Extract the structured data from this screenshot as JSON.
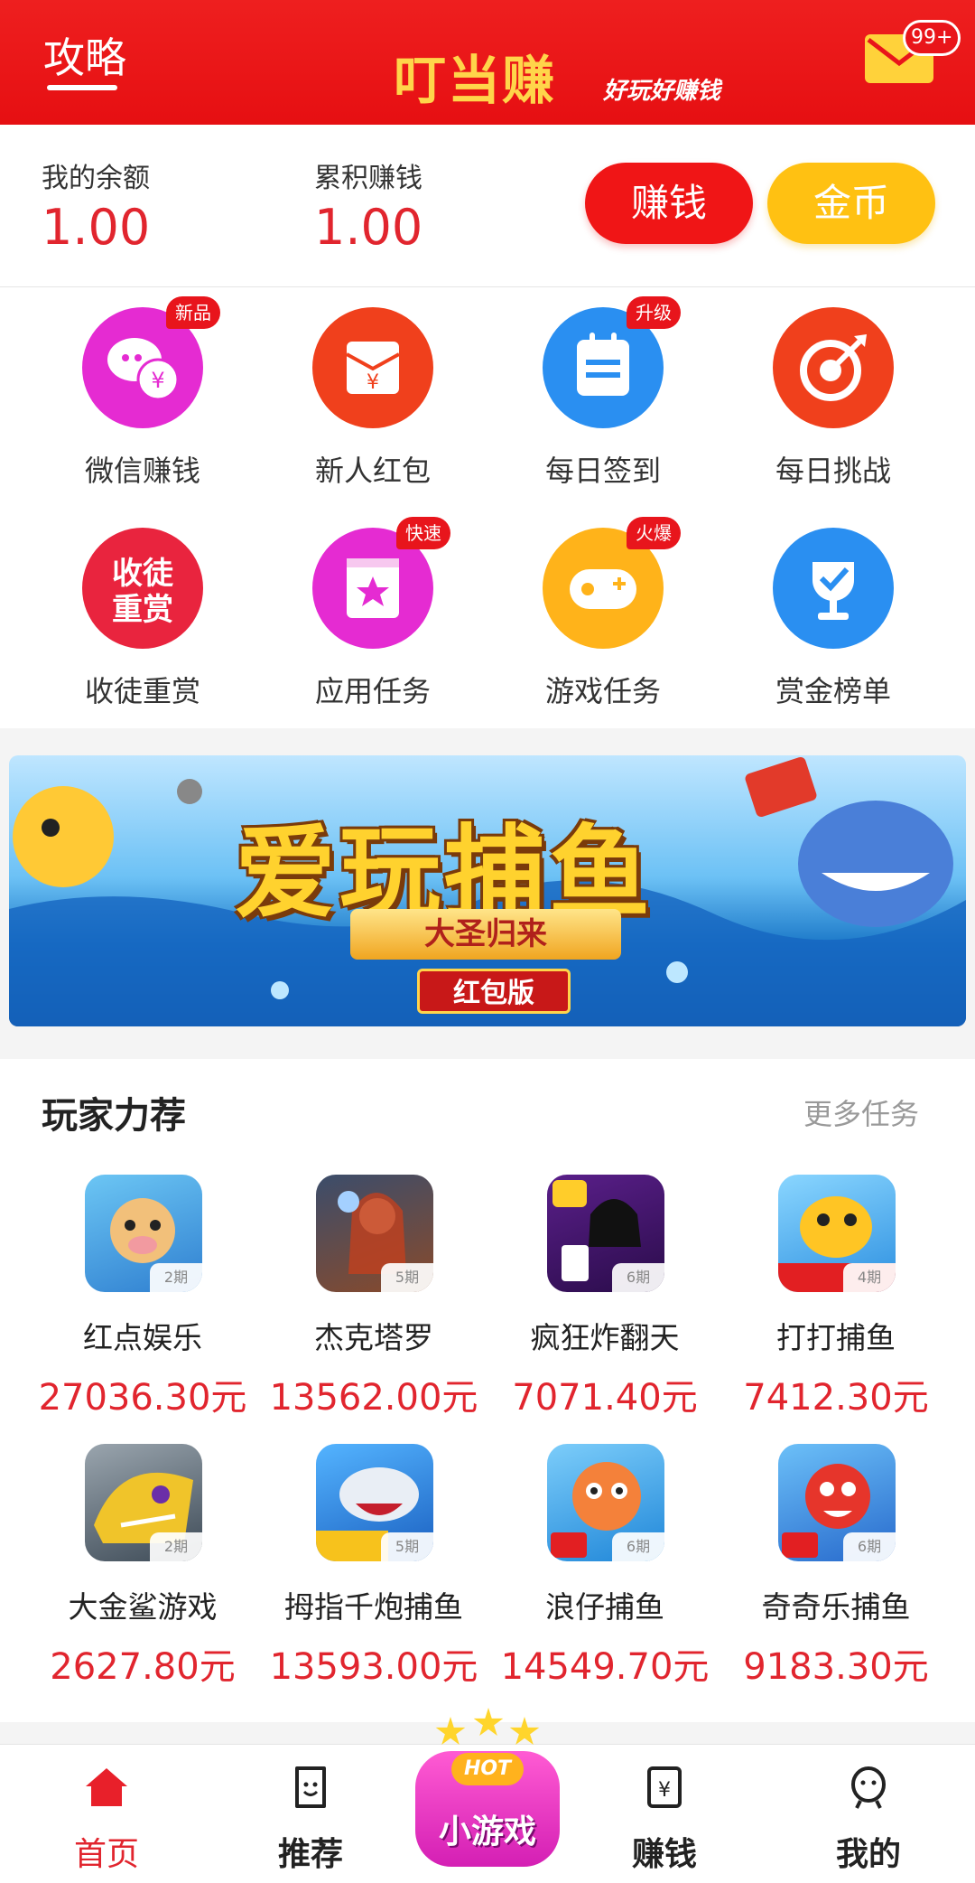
{
  "header": {
    "guide_label": "攻略",
    "brand": "叮当赚",
    "slogan": "好玩好赚钱",
    "mail_badge": "99+"
  },
  "balance": {
    "my_balance_label": "我的余额",
    "my_balance_value": "1.00",
    "total_earned_label": "累积赚钱",
    "total_earned_value": "1.00",
    "earn_button": "赚钱",
    "coin_button": "金币"
  },
  "grid": [
    {
      "label": "微信赚钱",
      "tag": "新品",
      "icon": "wechat-money-icon",
      "color": "#e52bd2"
    },
    {
      "label": "新人红包",
      "tag": "",
      "icon": "red-envelope-icon",
      "color": "#f0401c"
    },
    {
      "label": "每日签到",
      "tag": "升级",
      "icon": "calendar-icon",
      "color": "#2a8ff1"
    },
    {
      "label": "每日挑战",
      "tag": "",
      "icon": "target-icon",
      "color": "#f0401c"
    },
    {
      "label": "收徒重赏",
      "tag": "",
      "icon": "recruit-icon",
      "color": "#e9243e",
      "icon_text": [
        "收徒",
        "重赏"
      ]
    },
    {
      "label": "应用任务",
      "tag": "快速",
      "icon": "app-star-icon",
      "color": "#e52bd2"
    },
    {
      "label": "游戏任务",
      "tag": "火爆",
      "icon": "gamepad-icon",
      "color": "#ffb31a"
    },
    {
      "label": "赏金榜单",
      "tag": "",
      "icon": "trophy-icon",
      "color": "#2a8ff1"
    }
  ],
  "banner": {
    "title": "爱玩捕鱼",
    "subtitle": "大圣归来",
    "tag": "红包版"
  },
  "recommend": {
    "title": "玩家力荐",
    "more": "更多任务",
    "games": [
      {
        "name": "红点娱乐",
        "prize": "27036.30元",
        "period": "2期",
        "color": "#3fa3e8"
      },
      {
        "name": "杰克塔罗",
        "prize": "13562.00元",
        "period": "5期",
        "color": "#6a4b3a"
      },
      {
        "name": "疯狂炸翻天",
        "prize": "7071.40元",
        "period": "6期",
        "color": "#5a2a8a"
      },
      {
        "name": "打打捕鱼",
        "prize": "7412.30元",
        "period": "4期",
        "color": "#36b0ee"
      },
      {
        "name": "大金鲨游戏",
        "prize": "2627.80元",
        "period": "2期",
        "color": "#4a5a6a"
      },
      {
        "name": "拇指千炮捕鱼",
        "prize": "13593.00元",
        "period": "5期",
        "color": "#1e6fd0"
      },
      {
        "name": "浪仔捕鱼",
        "prize": "14549.70元",
        "period": "6期",
        "color": "#2fa8e6"
      },
      {
        "name": "奇奇乐捕鱼",
        "prize": "9183.30元",
        "period": "6期",
        "color": "#2a90e0"
      }
    ]
  },
  "nav": {
    "home": "首页",
    "recommend": "推荐",
    "mini_hot": "HOT",
    "mini_games": "小游戏",
    "earn": "赚钱",
    "mine": "我的"
  },
  "colors": {
    "primary_red": "#e60f12",
    "price_red": "#e1252e",
    "coin_yellow": "#ffc112"
  }
}
